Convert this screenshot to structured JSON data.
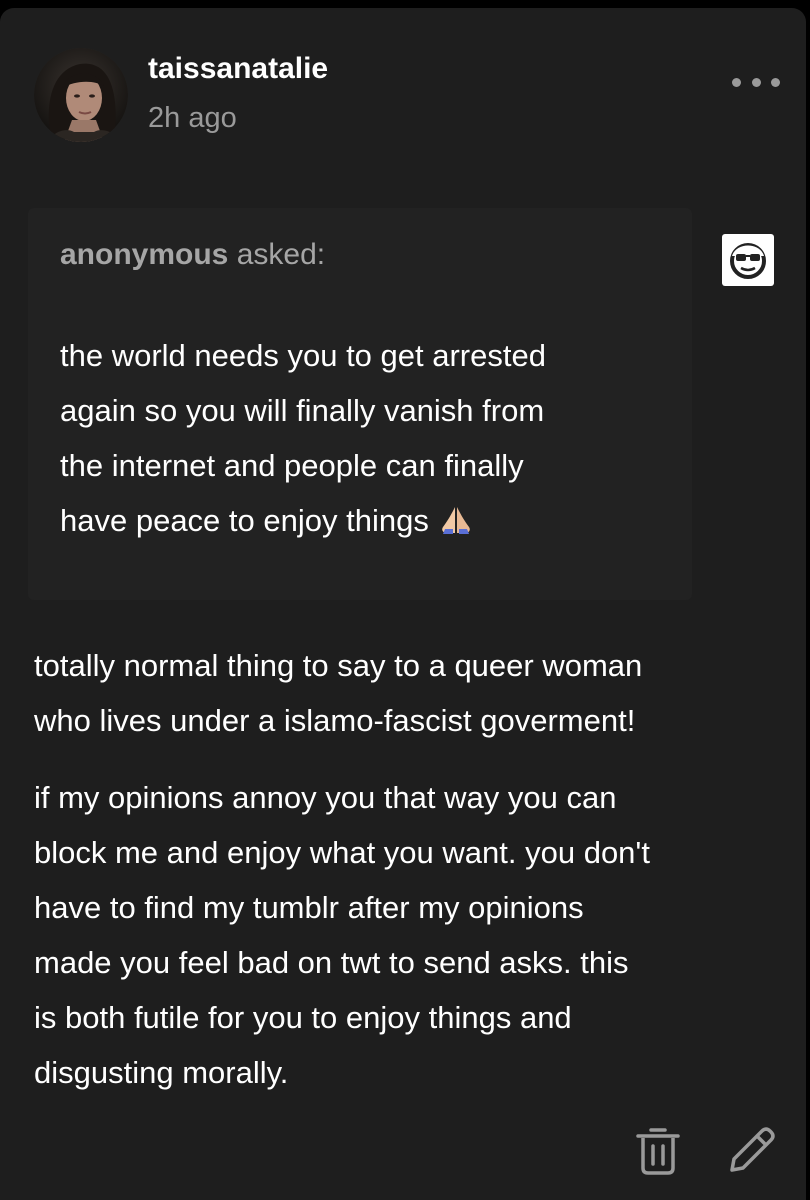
{
  "post": {
    "username": "taissanatalie",
    "timestamp": "2h ago",
    "more_icon": "more-horizontal-icon"
  },
  "ask": {
    "asker": "anonymous",
    "verb": " asked:",
    "lines": [
      "the world needs you to get arrested",
      "again so you will finally vanish from",
      "the internet and people can finally",
      "have peace to enjoy things"
    ],
    "emoji": "🙏",
    "anon_icon": "anonymous-sunglasses-icon"
  },
  "answer": {
    "paragraph1": [
      "totally normal thing to say to a queer woman",
      "who lives under a islamo-fascist goverment!"
    ],
    "paragraph2": [
      "if my opinions annoy you that way you can",
      "block me and enjoy what you want. you don't",
      "have to find my tumblr after my opinions",
      "made you feel bad on twt to send asks. this",
      "is both futile for you to enjoy things and",
      "disgusting morally."
    ]
  },
  "footer": {
    "delete_icon": "trash-icon",
    "edit_icon": "pencil-icon"
  },
  "colors": {
    "background": "#000000",
    "card": "#1e1e1e",
    "ask_box": "#222222",
    "text": "#ffffff",
    "muted": "#9a9a9a"
  }
}
